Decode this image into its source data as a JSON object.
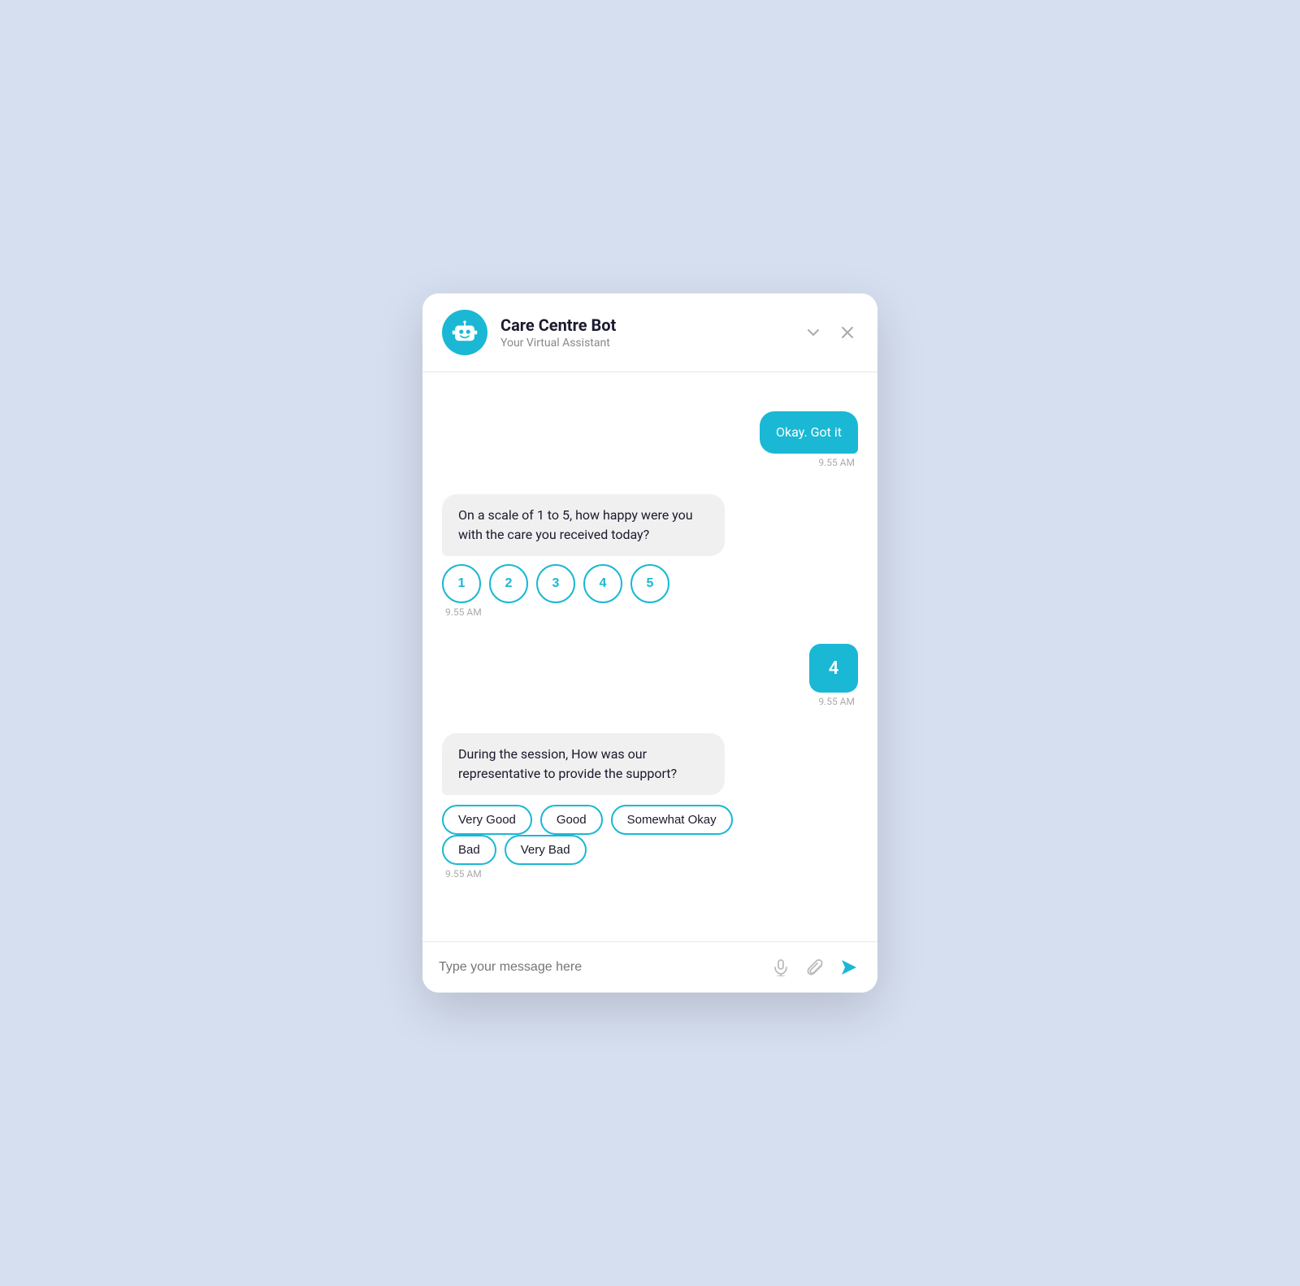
{
  "header": {
    "title": "Care Centre Bot",
    "subtitle": "Your Virtual Assistant",
    "chevron_label": "chevron-down",
    "close_label": "close"
  },
  "messages": [
    {
      "id": "msg1",
      "type": "user",
      "text": "Okay. Got it",
      "time": "9.55 AM"
    },
    {
      "id": "msg2",
      "type": "bot",
      "text": "On a scale of 1 to 5, how happy were you with the care you received today?",
      "time": "9.55 AM",
      "options": {
        "type": "rating",
        "values": [
          "1",
          "2",
          "3",
          "4",
          "5"
        ]
      }
    },
    {
      "id": "msg3",
      "type": "user_small",
      "text": "4",
      "time": "9.55 AM"
    },
    {
      "id": "msg4",
      "type": "bot",
      "text": "During the session, How was our representative to provide the support?",
      "time": "9.55 AM",
      "options": {
        "type": "choices",
        "values": [
          "Very Good",
          "Good",
          "Somewhat Okay",
          "Bad",
          "Very Bad"
        ]
      }
    }
  ],
  "footer": {
    "placeholder": "Type your message here",
    "mic_icon": "microphone",
    "attach_icon": "paperclip",
    "send_icon": "send"
  }
}
